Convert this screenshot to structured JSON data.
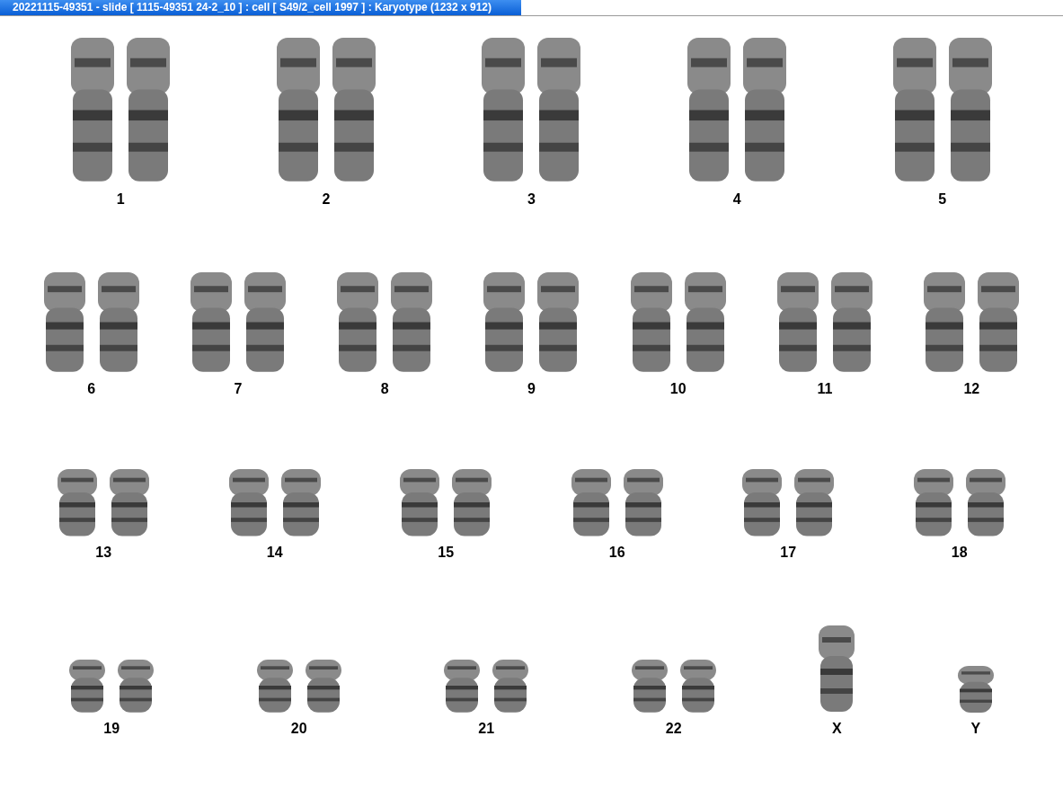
{
  "window": {
    "title": "20221115-49351 - slide [ 1115-49351 24-2_10 ] : cell [ S49/2_cell 1997 ] : Karyotype  (1232 x 912)"
  },
  "rows": [
    {
      "groups": [
        {
          "label": "1",
          "kind": "pair"
        },
        {
          "label": "2",
          "kind": "pair"
        },
        {
          "label": "3",
          "kind": "pair"
        },
        {
          "label": "4",
          "kind": "pair"
        },
        {
          "label": "5",
          "kind": "pair"
        }
      ]
    },
    {
      "groups": [
        {
          "label": "6",
          "kind": "pair"
        },
        {
          "label": "7",
          "kind": "pair"
        },
        {
          "label": "8",
          "kind": "pair"
        },
        {
          "label": "9",
          "kind": "pair"
        },
        {
          "label": "10",
          "kind": "pair"
        },
        {
          "label": "11",
          "kind": "pair"
        },
        {
          "label": "12",
          "kind": "pair"
        }
      ]
    },
    {
      "groups": [
        {
          "label": "13",
          "kind": "pair"
        },
        {
          "label": "14",
          "kind": "pair"
        },
        {
          "label": "15",
          "kind": "pair"
        },
        {
          "label": "16",
          "kind": "pair"
        },
        {
          "label": "17",
          "kind": "pair"
        },
        {
          "label": "18",
          "kind": "pair"
        }
      ]
    },
    {
      "groups": [
        {
          "label": "19",
          "kind": "pair"
        },
        {
          "label": "20",
          "kind": "pair"
        },
        {
          "label": "21",
          "kind": "pair"
        },
        {
          "label": "22",
          "kind": "pair"
        },
        {
          "label": "X",
          "kind": "single"
        },
        {
          "label": "Y",
          "kind": "single"
        }
      ]
    }
  ]
}
